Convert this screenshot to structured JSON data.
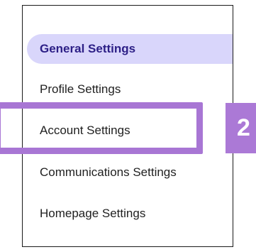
{
  "settings_menu": {
    "items": [
      {
        "label": "General Settings",
        "active": true
      },
      {
        "label": "Profile Settings",
        "active": false
      },
      {
        "label": "Account Settings",
        "active": false
      },
      {
        "label": "Communications Settings",
        "active": false
      },
      {
        "label": "Homepage Settings",
        "active": false
      }
    ]
  },
  "annotation": {
    "step_number": "2",
    "highlighted_item": "Account Settings"
  },
  "colors": {
    "active_background": "#d9d6fb",
    "active_text": "#2c1f86",
    "highlight": "#a876d4",
    "badge_background": "#ab79d6",
    "text": "#1f1f1f"
  }
}
